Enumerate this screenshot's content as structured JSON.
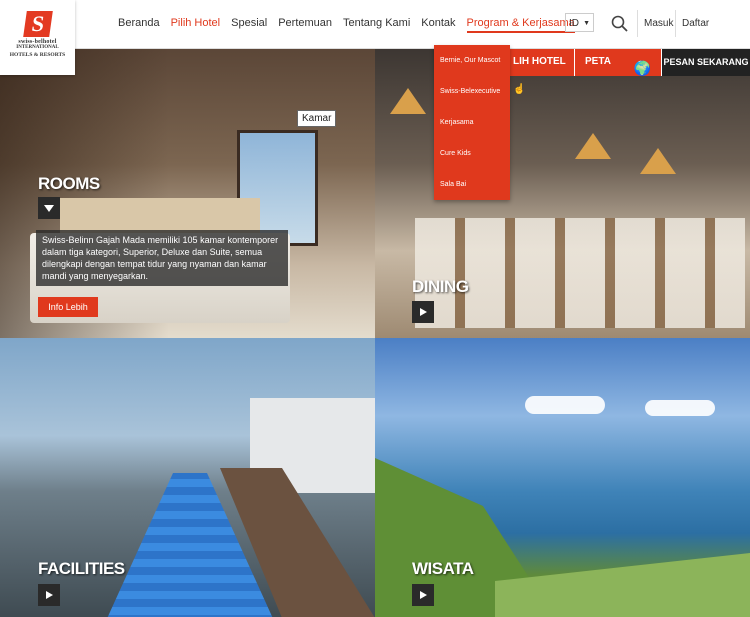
{
  "logo": {
    "line1": "swiss-belhotel",
    "line2": "INTERNATIONAL",
    "line3": "HOTELS & RESORTS"
  },
  "nav": {
    "items": [
      "Beranda",
      "Pilih Hotel",
      "Spesial",
      "Pertemuan",
      "Tentang Kami",
      "Kontak",
      "Program & Kerjasama"
    ],
    "active": "Pilih Hotel"
  },
  "header": {
    "lang": "ID",
    "login": "Masuk",
    "register": "Daftar"
  },
  "dropdown": {
    "items": [
      "Bernie, Our Mascot",
      "Swiss-Belexecutive",
      "Kerjasama",
      "Cure Kids",
      "Sala Bai"
    ]
  },
  "booking": {
    "hotel_label": "LIH HOTEL",
    "map_label": "PETA",
    "book_label": "PESAN SEKARANG"
  },
  "panels": {
    "rooms": {
      "title": "ROOMS",
      "tooltip": "Kamar",
      "description": "Swiss-Belinn Gajah Mada memiliki 105 kamar kontemporer dalam tiga kategori, Superior, Deluxe dan Suite, semua dilengkapi dengan tempat tidur yang nyaman dan kamar mandi yang menyegarkan.",
      "button": "Info Lebih"
    },
    "dining": {
      "title": "DINING"
    },
    "facilities": {
      "title": "FACILITIES"
    },
    "wisata": {
      "title": "WISATA"
    }
  },
  "colors": {
    "accent": "#e0391d",
    "dark": "#222222"
  }
}
